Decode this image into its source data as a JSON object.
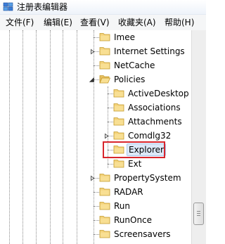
{
  "window": {
    "title": "注册表编辑器"
  },
  "menu": [
    {
      "label": "文件(F)"
    },
    {
      "label": "编辑(E)"
    },
    {
      "label": "查看(V)"
    },
    {
      "label": "收藏夹(A)"
    },
    {
      "label": "帮助(H)"
    }
  ],
  "tree": {
    "items": [
      {
        "label": "Imee",
        "expander": "none"
      },
      {
        "label": "Internet Settings",
        "expander": "collapsed"
      },
      {
        "label": "NetCache",
        "expander": "none"
      },
      {
        "label": "Policies",
        "expander": "expanded"
      },
      {
        "label": "ActiveDesktop",
        "expander": "none"
      },
      {
        "label": "Associations",
        "expander": "none"
      },
      {
        "label": "Attachments",
        "expander": "none"
      },
      {
        "label": "Comdlg32",
        "expander": "collapsed"
      },
      {
        "label": "Explorer",
        "expander": "none",
        "selected": true
      },
      {
        "label": "Ext",
        "expander": "none"
      },
      {
        "label": "PropertySystem",
        "expander": "collapsed"
      },
      {
        "label": "RADAR",
        "expander": "none"
      },
      {
        "label": "Run",
        "expander": "none"
      },
      {
        "label": "RunOnce",
        "expander": "none"
      },
      {
        "label": "Screensavers",
        "expander": "none"
      }
    ]
  },
  "colors": {
    "folder": "#f3d27a",
    "highlight_box": "#d8262d",
    "selection": "#dce8f8"
  },
  "icons": {
    "app": "registry-editor-icon",
    "folder": "folder-icon"
  }
}
